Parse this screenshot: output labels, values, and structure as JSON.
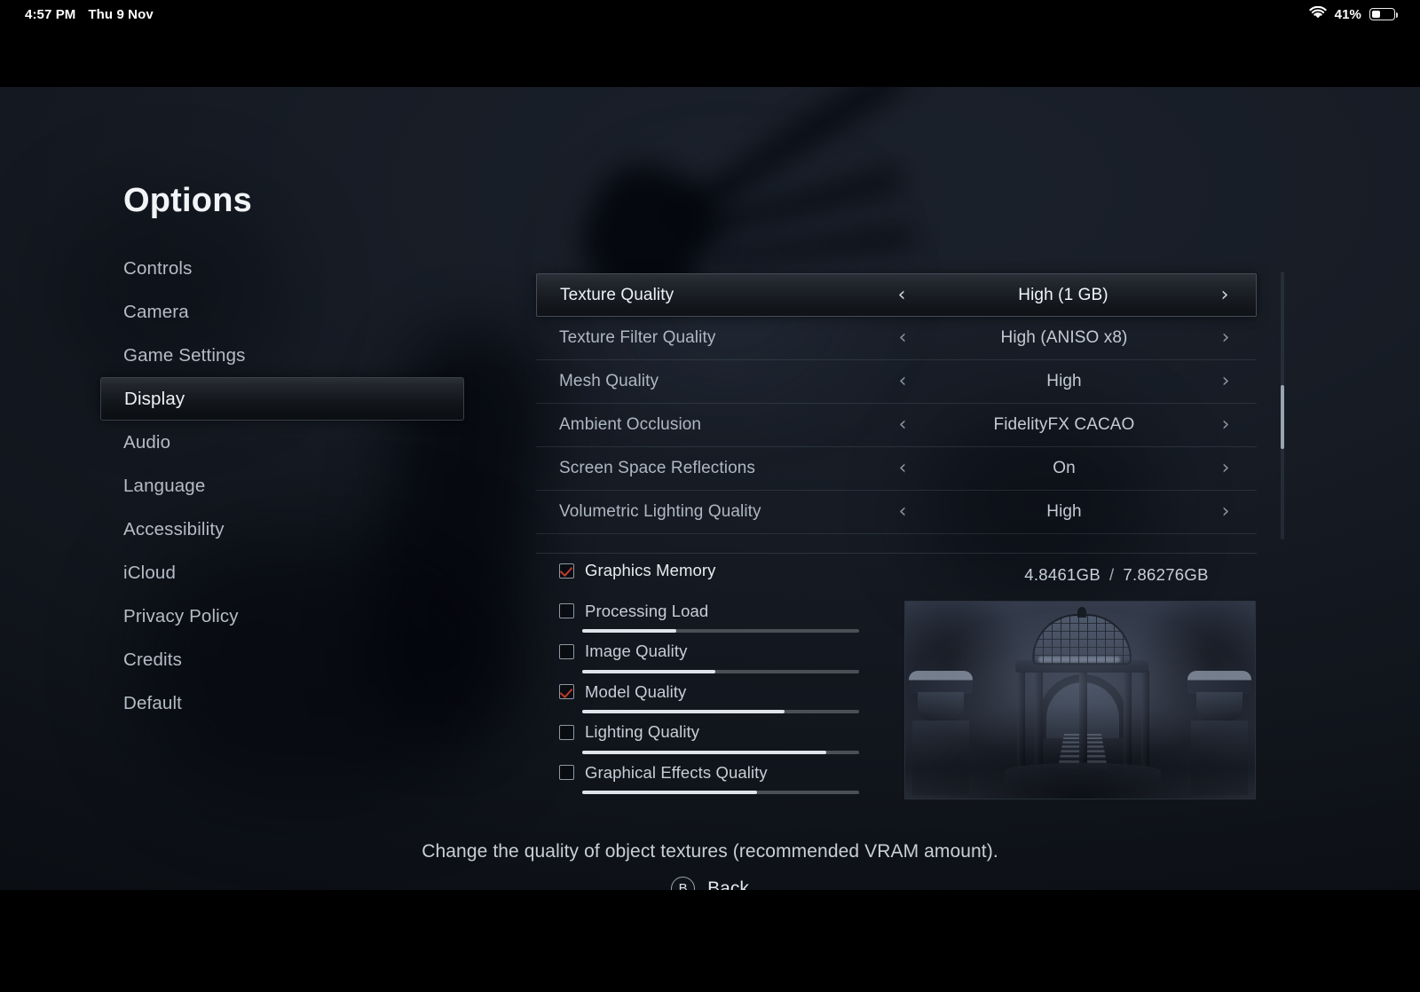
{
  "status_bar": {
    "time": "4:57 PM",
    "date": "Thu 9 Nov",
    "wifi_icon": "wifi-icon",
    "battery_percent": "41%",
    "battery_level": 41
  },
  "page": {
    "title": "Options"
  },
  "sidebar": {
    "items": [
      {
        "label": "Controls",
        "selected": false
      },
      {
        "label": "Camera",
        "selected": false
      },
      {
        "label": "Game Settings",
        "selected": false
      },
      {
        "label": "Display",
        "selected": true
      },
      {
        "label": "Audio",
        "selected": false
      },
      {
        "label": "Language",
        "selected": false
      },
      {
        "label": "Accessibility",
        "selected": false
      },
      {
        "label": "iCloud",
        "selected": false
      },
      {
        "label": "Privacy Policy",
        "selected": false
      },
      {
        "label": "Credits",
        "selected": false
      },
      {
        "label": "Default",
        "selected": false
      }
    ]
  },
  "settings": {
    "left_arrow": "‹",
    "right_arrow": "›",
    "rows": [
      {
        "label": "Texture Quality",
        "value": "High (1 GB)",
        "highlighted": true
      },
      {
        "label": "Texture Filter Quality",
        "value": "High (ANISO x8)",
        "highlighted": false
      },
      {
        "label": "Mesh Quality",
        "value": "High",
        "highlighted": false
      },
      {
        "label": "Ambient Occlusion",
        "value": "FidelityFX CACAO",
        "highlighted": false
      },
      {
        "label": "Screen Space Reflections",
        "value": "On",
        "highlighted": false
      },
      {
        "label": "Volumetric Lighting Quality",
        "value": "High",
        "highlighted": false
      }
    ]
  },
  "meters": {
    "vram_used": "4.8461GB",
    "vram_separator": "/",
    "vram_total": "7.86276GB",
    "rows": [
      {
        "label": "Graphics Memory",
        "checked": true,
        "has_bar": false,
        "fill_percent": 0
      },
      {
        "label": "Processing Load",
        "checked": false,
        "has_bar": true,
        "fill_percent": 34
      },
      {
        "label": "Image Quality",
        "checked": false,
        "has_bar": true,
        "fill_percent": 48
      },
      {
        "label": "Model Quality",
        "checked": true,
        "has_bar": true,
        "fill_percent": 73
      },
      {
        "label": "Lighting Quality",
        "checked": false,
        "has_bar": true,
        "fill_percent": 88
      },
      {
        "label": "Graphical Effects Quality",
        "checked": false,
        "has_bar": true,
        "fill_percent": 63
      }
    ]
  },
  "preview": {
    "name": "display-preview-thumbnail"
  },
  "footer": {
    "help_text": "Change the quality of object textures (recommended VRAM amount).",
    "back_button_glyph": "B",
    "back_label": "Back"
  },
  "colors": {
    "accent_check": "#c0392b",
    "text_primary": "#eef1f5",
    "text_secondary": "#aeb7c2",
    "bar_fill": "#dfe4ea",
    "bar_track": "#4a4f55",
    "background": "#10141b"
  }
}
